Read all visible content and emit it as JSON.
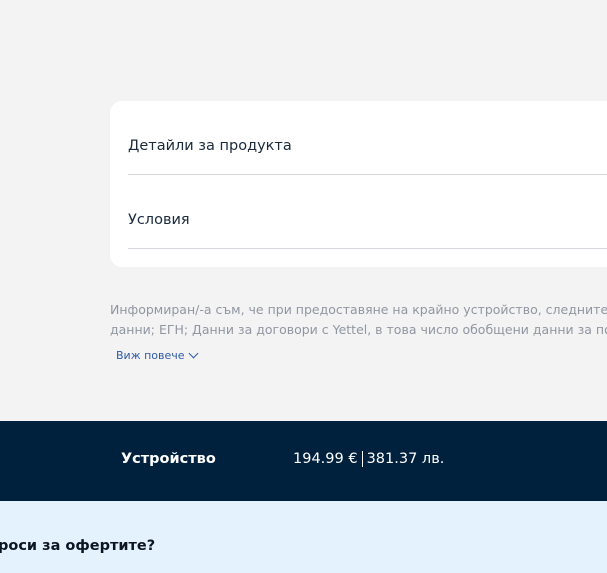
{
  "accordion": {
    "items": [
      {
        "label": "Детайли за продукта"
      },
      {
        "label": "Условия"
      }
    ]
  },
  "consent": {
    "line1": "Информиран/-а съм, че при предоставяне на крайно устройство, следните",
    "line2": "данни; ЕГН; Данни за договори с Yettel, в това число обобщени данни за по",
    "see_more": "Виж повече"
  },
  "summary": {
    "label": "Устройство",
    "price_eur": "194.99 €",
    "price_bgn": "381.37 лв."
  },
  "faq": {
    "title": "роси за офертите?"
  },
  "colors": {
    "background": "#f3f3f4",
    "summary_bar": "#00213d",
    "faq_band": "#e3f2fc",
    "link": "#2d5aa6"
  }
}
